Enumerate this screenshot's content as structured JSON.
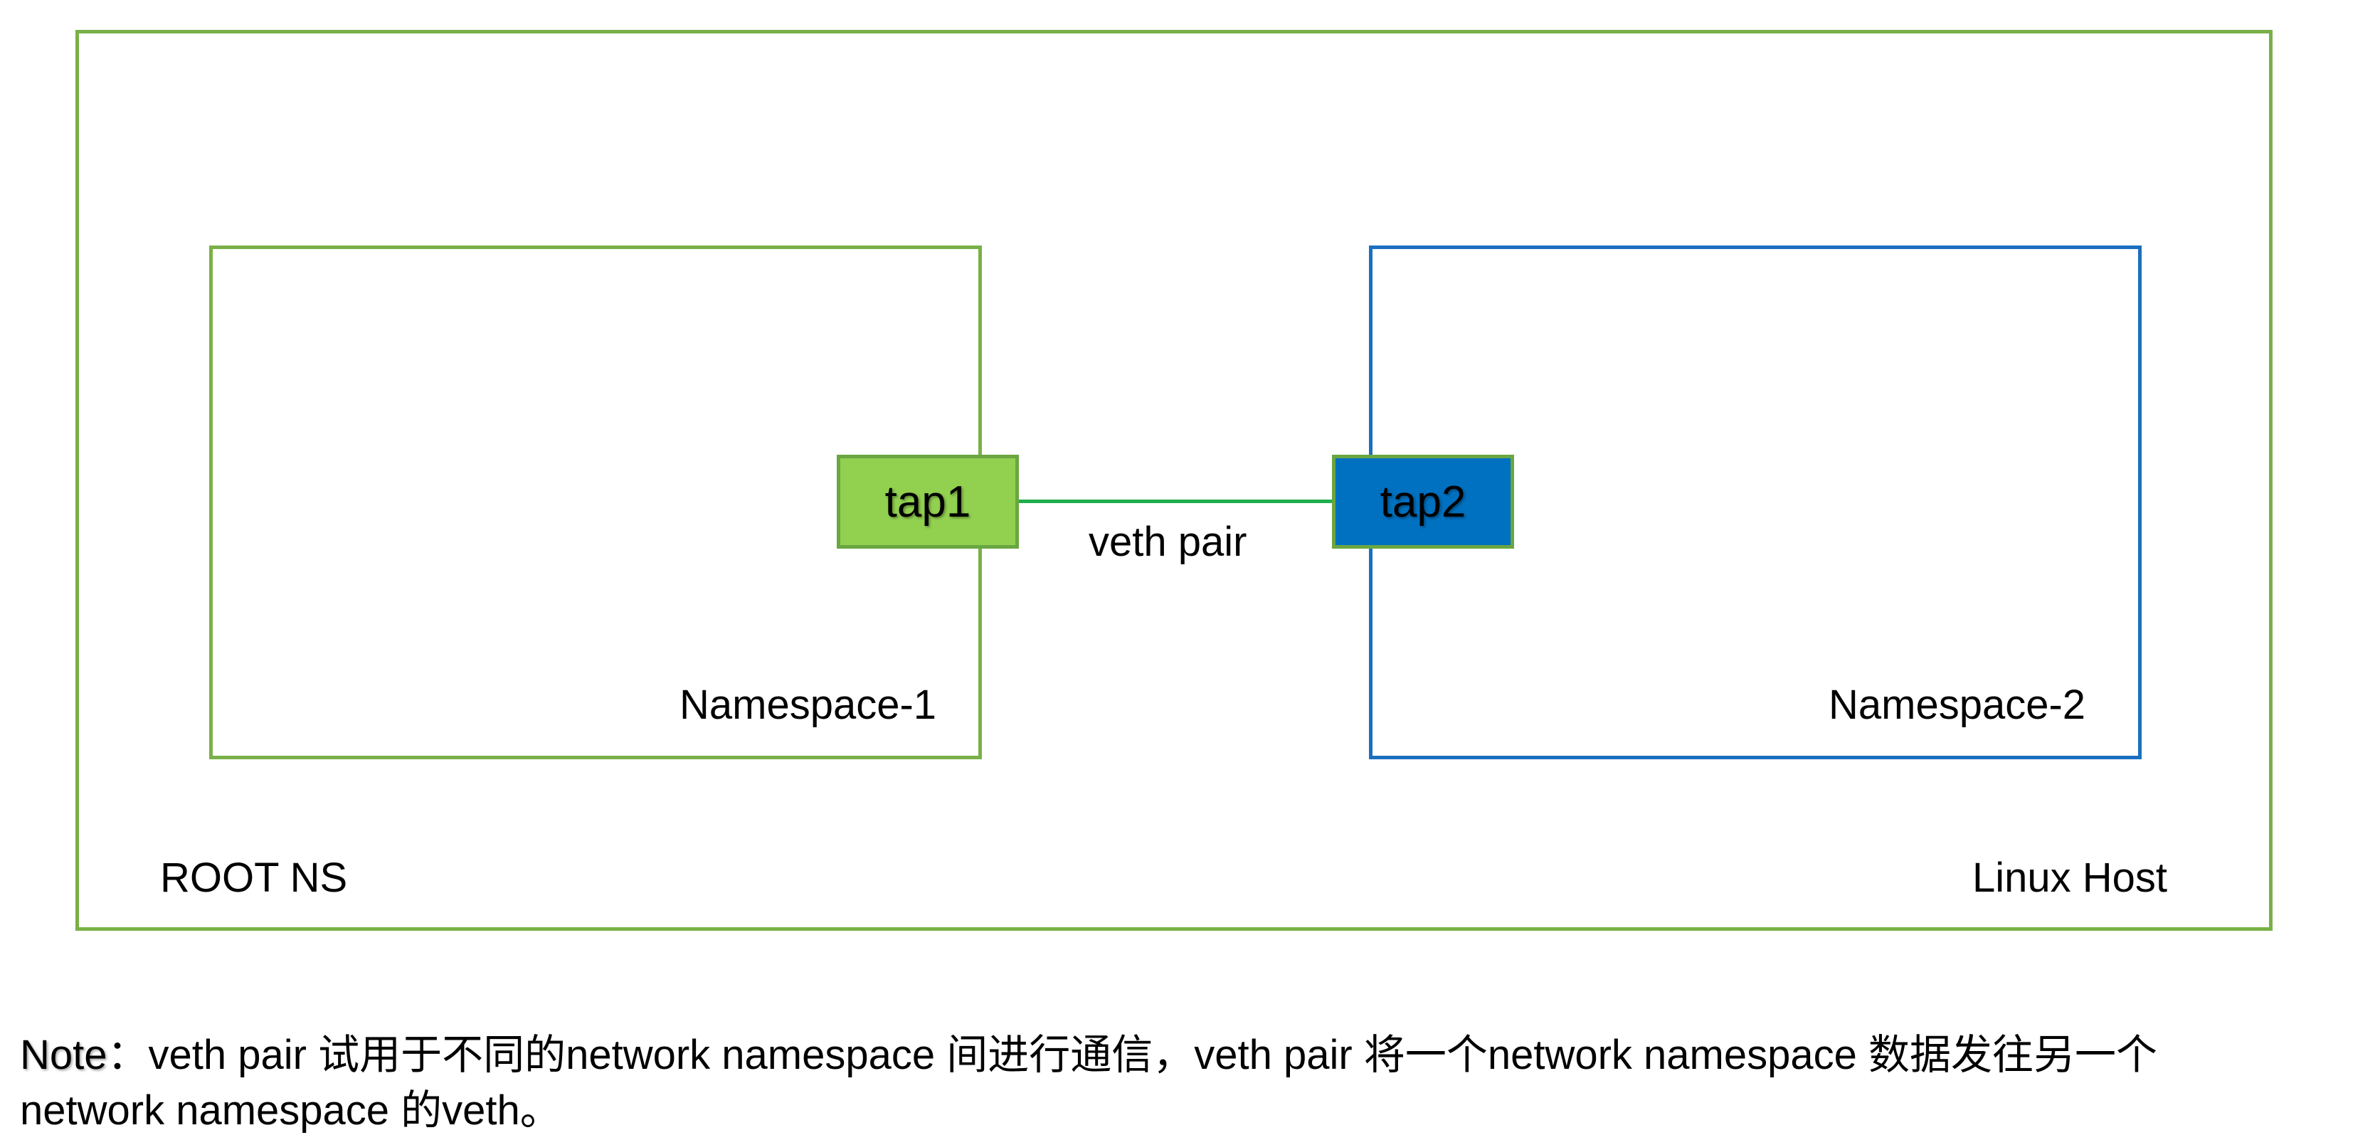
{
  "diagram": {
    "host_label": "Linux Host",
    "root_label": "ROOT NS",
    "namespace1_label": "Namespace-1",
    "namespace2_label": "Namespace-2",
    "tap1_label": "tap1",
    "tap2_label": "tap2",
    "link_label": "veth pair"
  },
  "note": {
    "prefix": "Note",
    "line1": "：veth pair 试用于不同的network namespace 间进行通信，veth pair 将一个network namespace 数据发往另一个",
    "line2": "network namespace 的veth。"
  },
  "colors": {
    "host_border": "#79b047",
    "namespace1_border": "#79b047",
    "namespace2_border": "#1a6fbf",
    "tap1_fill": "#92d050",
    "tap2_fill": "#0070c0",
    "tap_border": "#6aa641",
    "veth_line": "#1fae4b"
  }
}
